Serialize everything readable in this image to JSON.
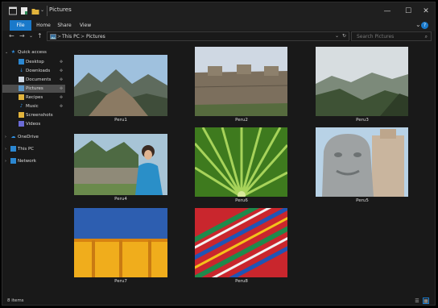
{
  "titlebar": {
    "title": "Pictures",
    "buttons": {
      "minimize": "—",
      "maximize": "☐",
      "close": "✕"
    }
  },
  "ribbon": {
    "tabs": [
      "File",
      "Home",
      "Share",
      "View"
    ],
    "expand": "⌄",
    "help": "?"
  },
  "nav": {
    "back": "←",
    "forward": "→",
    "recent": "⌄",
    "up": "↑"
  },
  "address": {
    "chevron": ">",
    "segments": [
      "This PC",
      "Pictures"
    ],
    "dropdown": "⌄",
    "refresh": "↻"
  },
  "search": {
    "placeholder": "Search Pictures",
    "icon": "search-icon"
  },
  "sidebar": {
    "quick_access": "Quick access",
    "items": [
      {
        "label": "Desktop",
        "icon": "desktop-icon",
        "pinned": true
      },
      {
        "label": "Downloads",
        "icon": "downloads-icon",
        "pinned": true
      },
      {
        "label": "Documents",
        "icon": "documents-icon",
        "pinned": true
      },
      {
        "label": "Pictures",
        "icon": "pictures-icon",
        "pinned": true,
        "selected": true
      },
      {
        "label": "Recipes",
        "icon": "folder-icon",
        "pinned": true
      },
      {
        "label": "Music",
        "icon": "music-icon",
        "pinned": true
      },
      {
        "label": "Screenshots",
        "icon": "folder-icon",
        "pinned": false
      },
      {
        "label": "Videos",
        "icon": "videos-icon",
        "pinned": false
      }
    ],
    "pin_glyph": "📌",
    "onedrive": "OneDrive",
    "this_pc": "This PC",
    "network": "Network"
  },
  "files": [
    {
      "name": "Peru1"
    },
    {
      "name": "Peru2"
    },
    {
      "name": "Peru3"
    },
    {
      "name": "Peru4"
    },
    {
      "name": "Peru6"
    },
    {
      "name": "Peru5"
    },
    {
      "name": "Peru7"
    },
    {
      "name": "Peru8"
    }
  ],
  "status": {
    "text": "8 items"
  },
  "colors": {
    "accent": "#1979ca",
    "background": "#191919",
    "chrome": "#1f1f1f",
    "selected": "#4d4d4d"
  }
}
